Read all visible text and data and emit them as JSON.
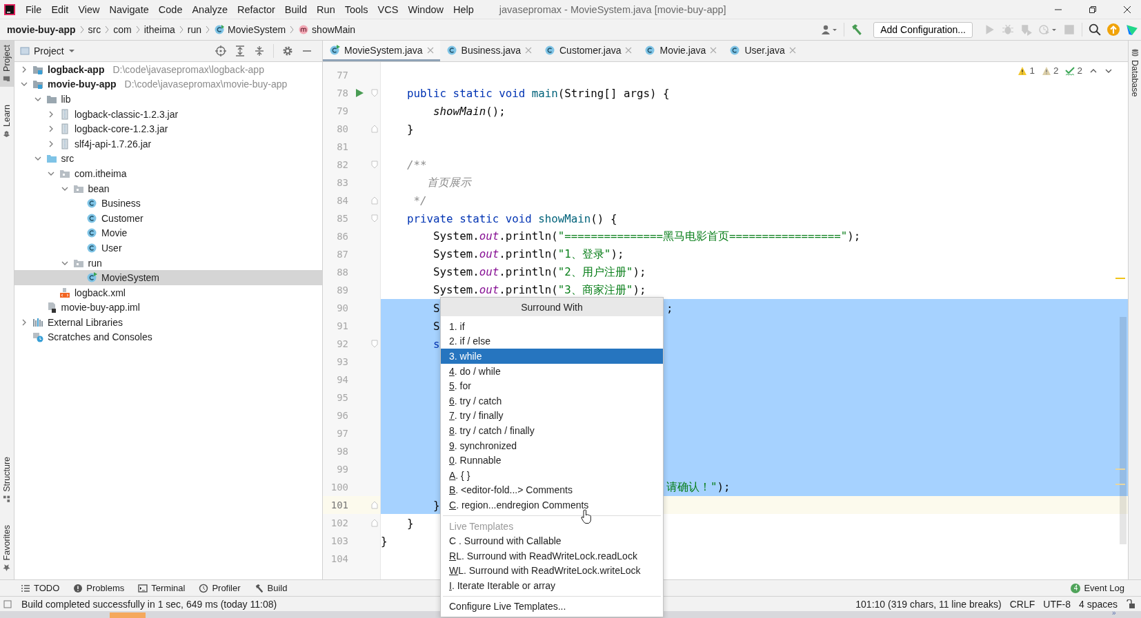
{
  "window": {
    "title": "javasepromax - MovieSystem.java [movie-buy-app]"
  },
  "menu": [
    "File",
    "Edit",
    "View",
    "Navigate",
    "Code",
    "Analyze",
    "Refactor",
    "Build",
    "Run",
    "Tools",
    "VCS",
    "Window",
    "Help"
  ],
  "breadcrumbs": [
    {
      "kind": "module",
      "label": "movie-buy-app"
    },
    {
      "kind": "plain",
      "label": "src"
    },
    {
      "kind": "plain",
      "label": "com"
    },
    {
      "kind": "plain",
      "label": "itheima"
    },
    {
      "kind": "plain",
      "label": "run"
    },
    {
      "kind": "class",
      "label": "MovieSystem"
    },
    {
      "kind": "method",
      "label": "showMain"
    }
  ],
  "toolbar": {
    "run_configuration": "Add Configuration..."
  },
  "left_stripe_top": [
    {
      "label": "Project",
      "kind": "project",
      "selected": true
    },
    {
      "label": "Learn",
      "kind": "learn",
      "selected": false
    }
  ],
  "left_stripe_bottom": [
    {
      "label": "Structure",
      "kind": "structure",
      "selected": false
    },
    {
      "label": "Favorites",
      "kind": "favorites",
      "selected": false
    }
  ],
  "right_stripe": [
    {
      "label": "Database",
      "kind": "database",
      "selected": false
    }
  ],
  "project": {
    "title": "Project",
    "tree": [
      {
        "kind": "module",
        "label": "logback-app",
        "path": "D:\\code\\javasepromax\\logback-app",
        "expanded": false,
        "selected": false
      },
      {
        "kind": "module",
        "label": "movie-buy-app",
        "path": "D:\\code\\javasepromax\\movie-buy-app",
        "expanded": true,
        "selected": false,
        "children": [
          {
            "kind": "folder",
            "label": "lib",
            "expanded": true,
            "selected": false,
            "children": [
              {
                "kind": "jar",
                "label": "logback-classic-1.2.3.jar",
                "expanded": false,
                "selected": false
              },
              {
                "kind": "jar",
                "label": "logback-core-1.2.3.jar",
                "expanded": false,
                "selected": false
              },
              {
                "kind": "jar",
                "label": "slf4j-api-1.7.26.jar",
                "expanded": false,
                "selected": false
              }
            ]
          },
          {
            "kind": "source",
            "label": "src",
            "expanded": true,
            "selected": false,
            "children": [
              {
                "kind": "package",
                "label": "com.itheima",
                "expanded": true,
                "selected": false,
                "children": [
                  {
                    "kind": "package",
                    "label": "bean",
                    "expanded": true,
                    "selected": false,
                    "children": [
                      {
                        "kind": "class",
                        "label": "Business",
                        "selected": false
                      },
                      {
                        "kind": "class",
                        "label": "Customer",
                        "selected": false
                      },
                      {
                        "kind": "class",
                        "label": "Movie",
                        "selected": false
                      },
                      {
                        "kind": "class",
                        "label": "User",
                        "selected": false
                      }
                    ]
                  },
                  {
                    "kind": "package",
                    "label": "run",
                    "expanded": true,
                    "selected": false,
                    "children": [
                      {
                        "kind": "main-class",
                        "label": "MovieSystem",
                        "selected": true
                      }
                    ]
                  }
                ]
              },
              {
                "kind": "xml",
                "label": "logback.xml",
                "selected": false
              }
            ]
          },
          {
            "kind": "iml",
            "label": "movie-buy-app.iml",
            "selected": false
          }
        ]
      },
      {
        "kind": "libraries",
        "label": "External Libraries",
        "expanded": false,
        "selected": false
      },
      {
        "kind": "scratches",
        "label": "Scratches and Consoles",
        "selected": false
      }
    ]
  },
  "tabs": [
    {
      "label": "MovieSystem.java",
      "kind": "main-class",
      "selected": true
    },
    {
      "label": "Business.java",
      "kind": "class",
      "selected": false
    },
    {
      "label": "Customer.java",
      "kind": "class",
      "selected": false
    },
    {
      "label": "Movie.java",
      "kind": "class",
      "selected": false
    },
    {
      "label": "User.java",
      "kind": "class",
      "selected": false
    }
  ],
  "inspections": [
    {
      "kind": "warning",
      "count": "1"
    },
    {
      "kind": "weak-warning",
      "count": "2"
    },
    {
      "kind": "typo",
      "count": "2"
    }
  ],
  "editor": {
    "lines": [
      {
        "number": "77",
        "selected": false,
        "current": false
      },
      {
        "number": "78",
        "selected": false,
        "current": false,
        "run": true,
        "fold_start": true,
        "tokens": [
          {
            "kind": "kw",
            "text": "    public static void "
          },
          {
            "kind": "decl",
            "text": "main"
          },
          {
            "kind": "plain",
            "text": "(String[] args) {"
          }
        ]
      },
      {
        "number": "79",
        "selected": false,
        "current": false,
        "tokens": [
          {
            "kind": "italic",
            "text": "        showMain"
          },
          {
            "kind": "plain",
            "text": "();"
          }
        ]
      },
      {
        "number": "80",
        "selected": false,
        "current": false,
        "fold_end": true,
        "tokens": [
          {
            "kind": "plain",
            "text": "    }"
          }
        ]
      },
      {
        "number": "81",
        "selected": false,
        "current": false
      },
      {
        "number": "82",
        "selected": false,
        "current": false,
        "fold_start": true,
        "tokens": [
          {
            "kind": "comment",
            "text": "    /**"
          }
        ]
      },
      {
        "number": "83",
        "selected": false,
        "current": false,
        "tokens": [
          {
            "kind": "comment",
            "text": "       首页展示"
          }
        ]
      },
      {
        "number": "84",
        "selected": false,
        "current": false,
        "fold_end": true,
        "tokens": [
          {
            "kind": "comment",
            "text": "     */"
          }
        ]
      },
      {
        "number": "85",
        "selected": false,
        "current": false,
        "fold_start": true,
        "tokens": [
          {
            "kind": "kw",
            "text": "    private static void "
          },
          {
            "kind": "decl",
            "text": "showMain"
          },
          {
            "kind": "plain",
            "text": "() {"
          }
        ]
      },
      {
        "number": "86",
        "selected": false,
        "current": false,
        "tokens": [
          {
            "kind": "plain",
            "text": "        System."
          },
          {
            "kind": "field",
            "text": "out"
          },
          {
            "kind": "plain",
            "text": ".println("
          },
          {
            "kind": "str",
            "text": "\"===============黑马电影首页=================\""
          },
          {
            "kind": "plain",
            "text": ");"
          }
        ]
      },
      {
        "number": "87",
        "selected": false,
        "current": false,
        "tokens": [
          {
            "kind": "plain",
            "text": "        System."
          },
          {
            "kind": "field",
            "text": "out"
          },
          {
            "kind": "plain",
            "text": ".println("
          },
          {
            "kind": "str",
            "text": "\"1、登录\""
          },
          {
            "kind": "plain",
            "text": ");"
          }
        ]
      },
      {
        "number": "88",
        "selected": false,
        "current": false,
        "tokens": [
          {
            "kind": "plain",
            "text": "        System."
          },
          {
            "kind": "field",
            "text": "out"
          },
          {
            "kind": "plain",
            "text": ".println("
          },
          {
            "kind": "str",
            "text": "\"2、用户注册\""
          },
          {
            "kind": "plain",
            "text": ");"
          }
        ]
      },
      {
        "number": "89",
        "selected": false,
        "current": false,
        "tokens": [
          {
            "kind": "plain",
            "text": "        System."
          },
          {
            "kind": "field",
            "text": "out"
          },
          {
            "kind": "plain",
            "text": ".println("
          },
          {
            "kind": "str",
            "text": "\"3、商家注册\""
          },
          {
            "kind": "plain",
            "text": ");"
          }
        ]
      },
      {
        "number": "90",
        "selected": true,
        "current": false,
        "tokens": [
          {
            "kind": "plain",
            "text": "        S"
          }
        ],
        "tail": [
          {
            "kind": "plain",
            "text": ";"
          }
        ]
      },
      {
        "number": "91",
        "selected": true,
        "current": false,
        "tokens": [
          {
            "kind": "plain",
            "text": "        S"
          }
        ]
      },
      {
        "number": "92",
        "selected": true,
        "current": false,
        "fold_start": true,
        "tokens": [
          {
            "kind": "kw",
            "text": "        s"
          }
        ]
      },
      {
        "number": "93",
        "selected": true,
        "current": false
      },
      {
        "number": "94",
        "selected": true,
        "current": false
      },
      {
        "number": "95",
        "selected": true,
        "current": false
      },
      {
        "number": "96",
        "selected": true,
        "current": false
      },
      {
        "number": "97",
        "selected": true,
        "current": false
      },
      {
        "number": "98",
        "selected": true,
        "current": false
      },
      {
        "number": "99",
        "selected": true,
        "current": false
      },
      {
        "number": "100",
        "selected": true,
        "current": false,
        "tail": [
          {
            "kind": "str",
            "text": "请确认！\""
          },
          {
            "kind": "plain",
            "text": ");"
          }
        ]
      },
      {
        "number": "101",
        "selected": true,
        "current": true,
        "fold_end": true,
        "tokens": [
          {
            "kind": "plain",
            "text": "        }"
          }
        ]
      },
      {
        "number": "102",
        "selected": false,
        "current": false,
        "fold_end": true,
        "tokens": [
          {
            "kind": "plain",
            "text": "    }"
          }
        ]
      },
      {
        "number": "103",
        "selected": false,
        "current": false,
        "tokens": [
          {
            "kind": "plain",
            "text": "}"
          }
        ]
      },
      {
        "number": "104",
        "selected": false,
        "current": false
      }
    ]
  },
  "popup": {
    "title": "Surround With",
    "items": [
      {
        "key": "1",
        "rest": ". if",
        "underlined": false,
        "selected": false
      },
      {
        "key": "2",
        "rest": ". if / else",
        "underlined": false,
        "selected": false
      },
      {
        "key": "3",
        "rest": ". while",
        "underlined": false,
        "selected": true
      },
      {
        "key": "4",
        "rest": ". do / while",
        "underlined": true,
        "selected": false
      },
      {
        "key": "5",
        "rest": ". for",
        "underlined": true,
        "selected": false
      },
      {
        "key": "6",
        "rest": ". try / catch",
        "underlined": true,
        "selected": false
      },
      {
        "key": "7",
        "rest": ". try / finally",
        "underlined": true,
        "selected": false
      },
      {
        "key": "8",
        "rest": ". try / catch / finally",
        "underlined": true,
        "selected": false
      },
      {
        "key": "9",
        "rest": ". synchronized",
        "underlined": true,
        "selected": false
      },
      {
        "key": "0",
        "rest": ". Runnable",
        "underlined": true,
        "selected": false
      },
      {
        "key": "A",
        "rest": ". { }",
        "underlined": true,
        "selected": false
      },
      {
        "key": "B",
        "rest": ". <editor-fold...> Comments",
        "underlined": true,
        "selected": false
      },
      {
        "key": "C",
        "rest": ". region...endregion Comments",
        "underlined": true,
        "selected": false
      }
    ],
    "templates_heading": "Live Templates",
    "templates": [
      {
        "key": "C",
        "rest": " . Surround with Callable",
        "underlined": false,
        "selected": false
      },
      {
        "key": "R",
        "rest": "L. Surround with ReadWriteLock.readLock",
        "underlined": true,
        "selected": false
      },
      {
        "key": "W",
        "rest": "L. Surround with ReadWriteLock.writeLock",
        "underlined": true,
        "selected": false
      },
      {
        "key": "I",
        "rest": ". Iterate Iterable or array",
        "underlined": true,
        "selected": false
      }
    ],
    "footer": "Configure Live Templates..."
  },
  "tool_buttons": [
    {
      "kind": "todo",
      "label": "TODO"
    },
    {
      "kind": "problems",
      "label": "Problems"
    },
    {
      "kind": "terminal",
      "label": "Terminal"
    },
    {
      "kind": "profiler",
      "label": "Profiler"
    },
    {
      "kind": "build",
      "label": "Build"
    }
  ],
  "event_log": {
    "badge": "4",
    "label": "Event Log"
  },
  "status": {
    "message": "Build completed successfully in 1 sec, 649 ms (today 11:08)",
    "position": "101:10 (319 chars, 11 line breaks)",
    "line_separator": "CRLF",
    "encoding": "UTF-8",
    "indent": "4 spaces"
  },
  "taskbar_overflow": "»"
}
